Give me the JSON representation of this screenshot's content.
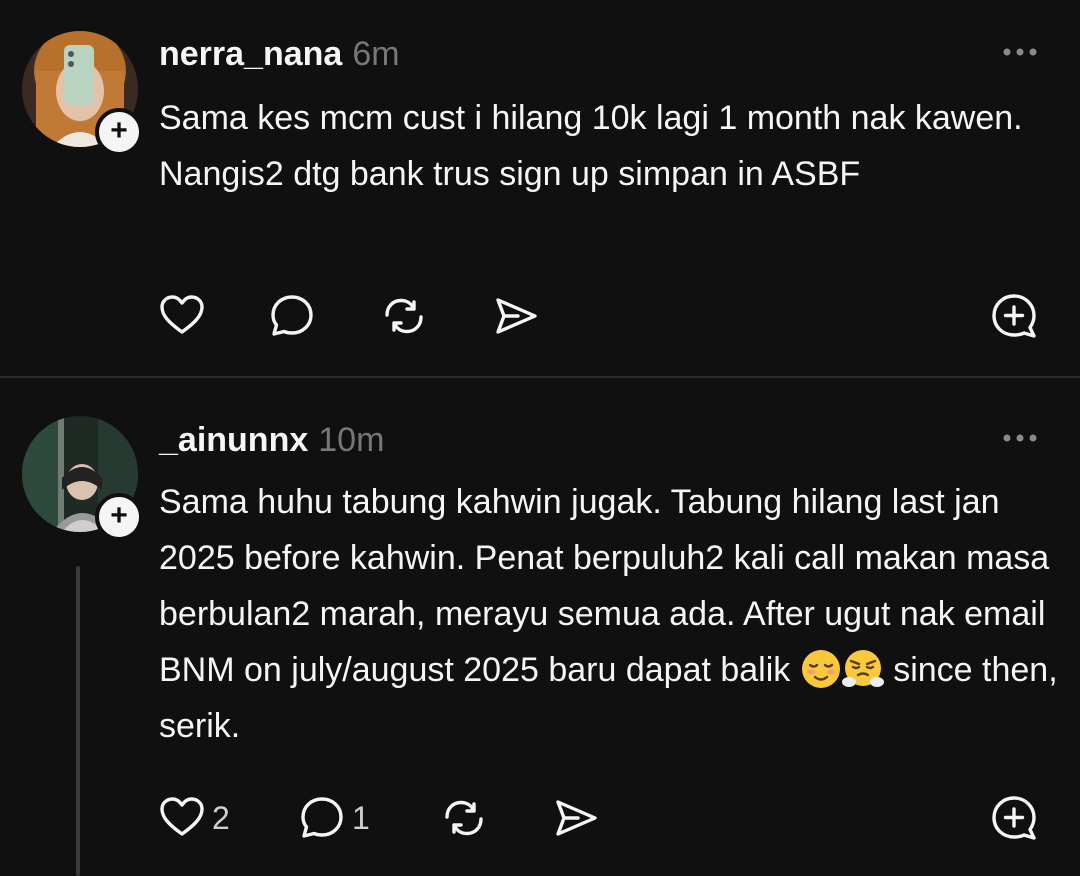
{
  "posts": [
    {
      "username": "nerra_nana",
      "time": "6m",
      "text": "Sama kes mcm cust i hilang 10k lagi 1 month nak kawen. Nangis2 dtg bank trus sign up simpan in ASBF",
      "follow_symbol": "+",
      "likes": "",
      "replies": ""
    },
    {
      "username": "_ainunnx",
      "time": "10m",
      "text_before_emoji": "Sama huhu tabung kahwin jugak. Tabung hilang last jan 2025 before kahwin. Penat berpuluh2 kali call makan masa berbulan2 marah, merayu semua ada. After ugut nak email BNM on july/august 2025 baru dapat balik ",
      "emojis": "😌😤",
      "text_after_emoji": " since then, serik.",
      "follow_symbol": "+",
      "likes": "2",
      "replies": "1"
    }
  ],
  "icons": [
    "heart-icon",
    "comment-icon",
    "repost-icon",
    "share-icon",
    "add-to-feed-icon",
    "more-options-icon"
  ],
  "colors": {
    "background": "#101010",
    "text": "#f3f5f7",
    "muted": "#777777",
    "divider": "#2a2a2a"
  }
}
